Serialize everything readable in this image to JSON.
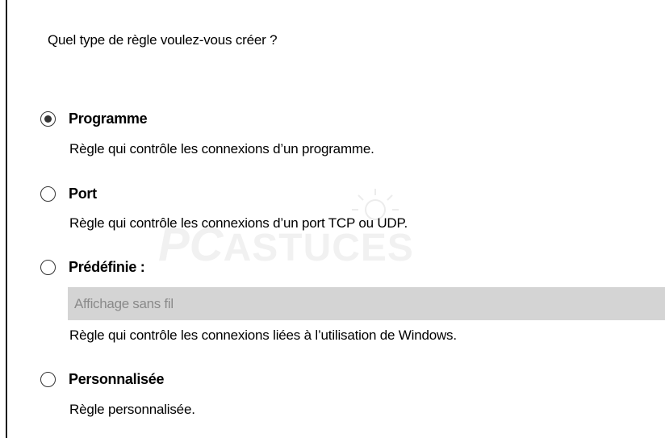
{
  "question": "Quel type de règle voulez-vous créer ?",
  "options": [
    {
      "label": "Programme",
      "description": "Règle qui contrôle les connexions d’un programme.",
      "checked": true
    },
    {
      "label": "Port",
      "description": "Règle qui contrôle les connexions d’un port TCP ou UDP.",
      "checked": false
    },
    {
      "label": "Prédéfinie :",
      "description": "Règle qui contrôle les connexions liées à l’utilisation de Windows.",
      "checked": false,
      "select_value": "Affichage sans fil"
    },
    {
      "label": "Personnalisée",
      "description": "Règle personnalisée.",
      "checked": false
    }
  ],
  "watermark": {
    "pc": "PC",
    "rest": "ASTUCES"
  }
}
